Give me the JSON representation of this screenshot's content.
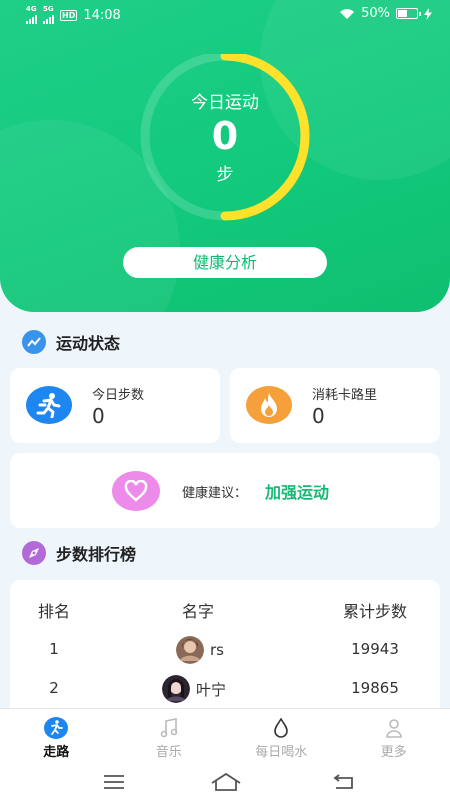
{
  "status_bar": {
    "net1": "4G",
    "net2": "5G",
    "hd": "HD",
    "time": "14:08",
    "battery": "50%"
  },
  "ring": {
    "title": "今日运动",
    "value": "0",
    "unit": "步",
    "progress": 0.5
  },
  "health_button": "健康分析",
  "activity": {
    "title": "运动状态",
    "steps": {
      "label": "今日步数",
      "value": "0"
    },
    "calories": {
      "label": "消耗卡路里",
      "value": "0"
    },
    "advice": {
      "label": "健康建议：",
      "value": "加强运动"
    }
  },
  "ranking": {
    "title": "步数排行榜",
    "columns": [
      "排名",
      "名字",
      "累计步数"
    ],
    "rows": [
      {
        "rank": "1",
        "name": "rs",
        "steps": "19943"
      },
      {
        "rank": "2",
        "name": "叶宁",
        "steps": "19865"
      }
    ]
  },
  "tabs": [
    {
      "label": "走路",
      "icon": "walk-icon"
    },
    {
      "label": "音乐",
      "icon": "music-icon"
    },
    {
      "label": "每日喝水",
      "icon": "water-drop-icon"
    },
    {
      "label": "更多",
      "icon": "person-icon"
    }
  ],
  "colors": {
    "green": "#14c47c",
    "ring_yellow": "#fde12b",
    "advice_green": "#19b876",
    "orange": "#f5a03a",
    "blue": "#1e86f0",
    "pink": "#ec8bea"
  }
}
